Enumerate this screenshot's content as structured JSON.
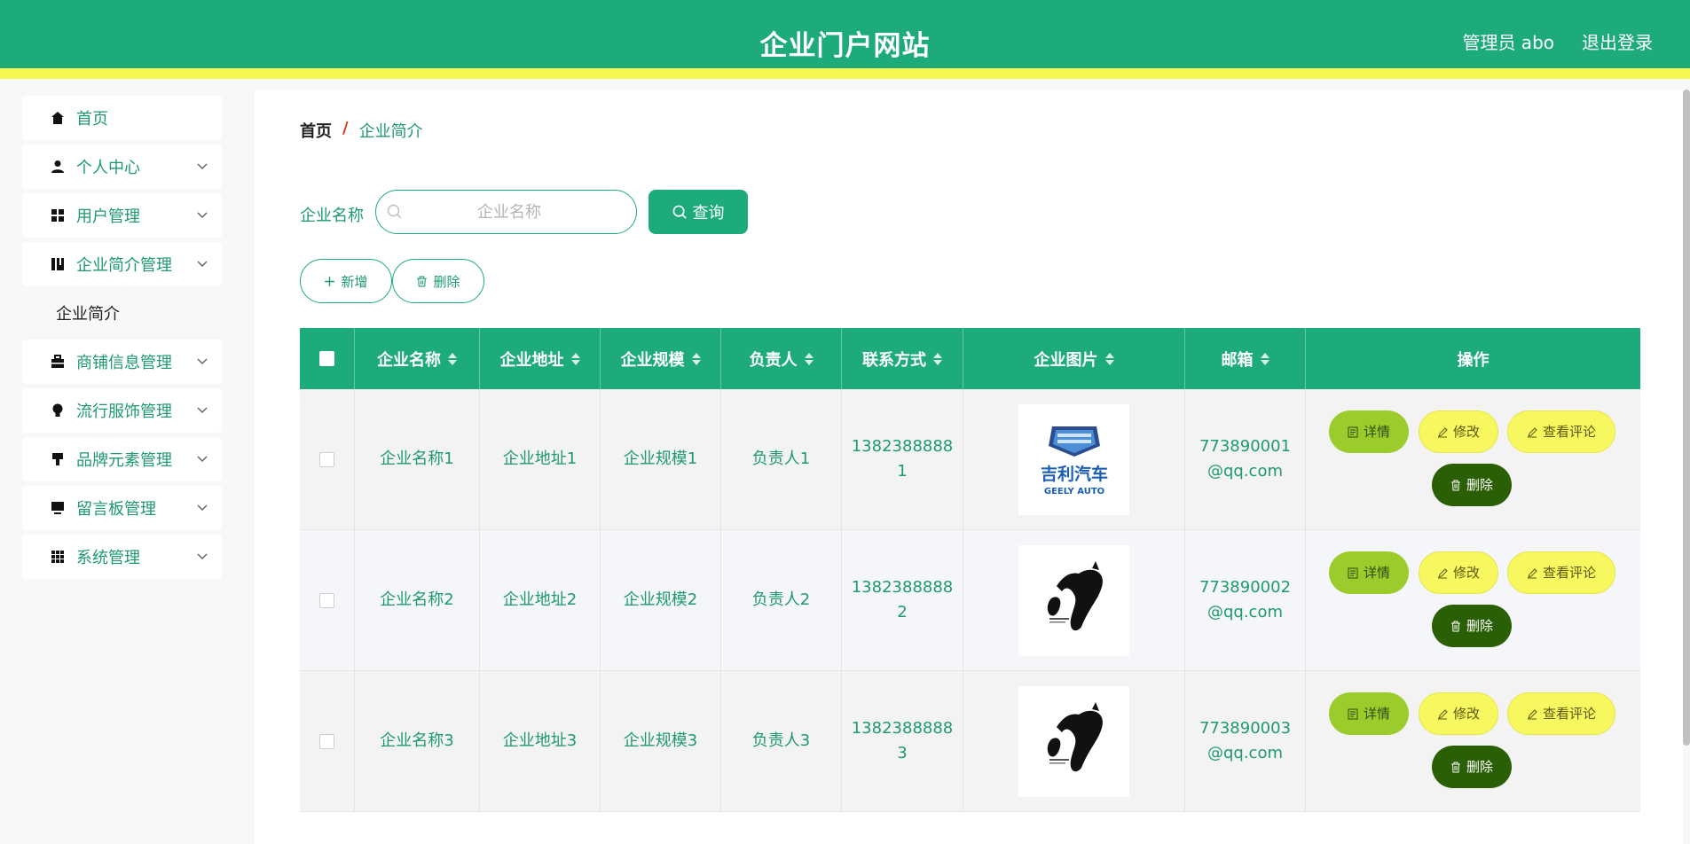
{
  "header": {
    "title": "企业门户网站",
    "admin": "管理员 abo",
    "logout": "退出登录"
  },
  "sidebar": {
    "items": [
      {
        "label": "首页",
        "icon": "home-icon"
      },
      {
        "label": "个人中心",
        "icon": "user-icon"
      },
      {
        "label": "用户管理",
        "icon": "grid-icon"
      },
      {
        "label": "企业简介管理",
        "icon": "book-icon"
      },
      {
        "label": "商铺信息管理",
        "icon": "briefcase-icon"
      },
      {
        "label": "流行服饰管理",
        "icon": "bulb-icon"
      },
      {
        "label": "品牌元素管理",
        "icon": "brush-icon"
      },
      {
        "label": "留言板管理",
        "icon": "monitor-icon"
      },
      {
        "label": "系统管理",
        "icon": "apps-icon"
      }
    ],
    "subitem": "企业简介"
  },
  "breadcrumb": {
    "home": "首页",
    "sep": "/",
    "current": "企业简介"
  },
  "search": {
    "label": "企业名称",
    "placeholder": "企业名称",
    "button": "查询"
  },
  "actions": {
    "add": "新增",
    "delete": "删除"
  },
  "table": {
    "columns": [
      "企业名称",
      "企业地址",
      "企业规模",
      "负责人",
      "联系方式",
      "企业图片",
      "邮箱",
      "操作"
    ],
    "rows": [
      {
        "name": "企业名称1",
        "address": "企业地址1",
        "scale": "企业规模1",
        "owner": "负责人1",
        "phone_a": "1382388888",
        "phone_b": "1",
        "email_a": "773890001",
        "email_b": "@qq.com",
        "image": "geely-logo"
      },
      {
        "name": "企业名称2",
        "address": "企业地址2",
        "scale": "企业规模2",
        "owner": "负责人2",
        "phone_a": "1382388888",
        "phone_b": "2",
        "email_a": "773890002",
        "email_b": "@qq.com",
        "image": "horse-logo"
      },
      {
        "name": "企业名称3",
        "address": "企业地址3",
        "scale": "企业规模3",
        "owner": "负责人3",
        "phone_a": "1382388888",
        "phone_b": "3",
        "email_a": "773890003",
        "email_b": "@qq.com",
        "image": "horse-logo"
      }
    ],
    "row_buttons": {
      "detail": "详情",
      "edit": "修改",
      "comment": "查看评论",
      "delete": "删除"
    }
  },
  "logo_text": {
    "geely_cn": "吉利汽车",
    "geely_en": "GEELY AUTO"
  },
  "colors": {
    "primary": "#1eab7b",
    "accent_bar": "#f5f750",
    "delete_btn": "#2a5f06",
    "detail_btn": "#9ccc2c",
    "edit_btn": "#f7f760"
  }
}
